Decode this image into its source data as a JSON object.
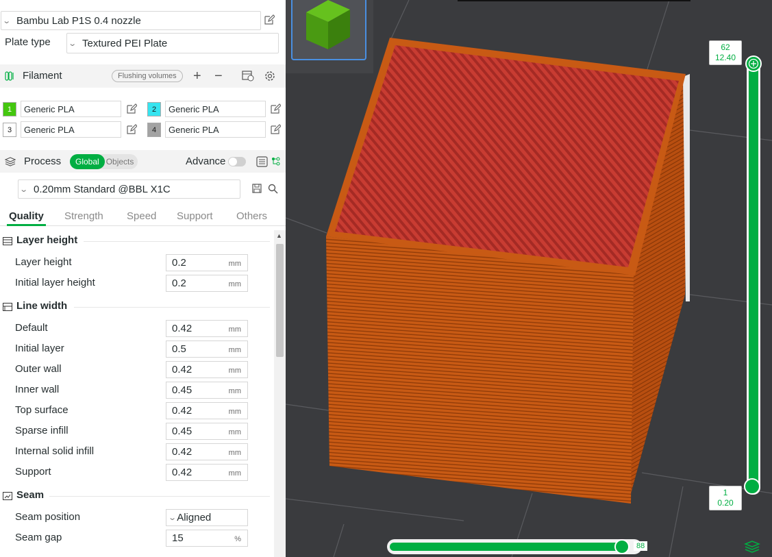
{
  "printer": {
    "name": "Bambu Lab P1S 0.4 nozzle"
  },
  "plate": {
    "label": "Plate type",
    "value": "Textured PEI Plate"
  },
  "filament": {
    "title": "Filament",
    "flushing_label": "Flushing volumes",
    "add_label": "+",
    "remove_label": "−",
    "slots": [
      {
        "index": "1",
        "name": "Generic PLA",
        "color": "#44c70f"
      },
      {
        "index": "2",
        "name": "Generic PLA",
        "color": "#36e4f0"
      },
      {
        "index": "3",
        "name": "Generic PLA",
        "color": "#ffffff"
      },
      {
        "index": "4",
        "name": "Generic PLA",
        "color": "#a3a3a3"
      }
    ]
  },
  "process": {
    "title": "Process",
    "global_label": "Global",
    "objects_label": "Objects",
    "advance_label": "Advance",
    "advance_on": false,
    "profile": "0.20mm Standard @BBL X1C"
  },
  "tabs": [
    "Quality",
    "Strength",
    "Speed",
    "Support",
    "Others"
  ],
  "active_tab": "Quality",
  "groups": {
    "layer_height": {
      "title": "Layer height",
      "rows": [
        {
          "label": "Layer height",
          "value": "0.2",
          "unit": "mm"
        },
        {
          "label": "Initial layer height",
          "value": "0.2",
          "unit": "mm"
        }
      ]
    },
    "line_width": {
      "title": "Line width",
      "rows": [
        {
          "label": "Default",
          "value": "0.42",
          "unit": "mm"
        },
        {
          "label": "Initial layer",
          "value": "0.5",
          "unit": "mm"
        },
        {
          "label": "Outer wall",
          "value": "0.42",
          "unit": "mm"
        },
        {
          "label": "Inner wall",
          "value": "0.45",
          "unit": "mm"
        },
        {
          "label": "Top surface",
          "value": "0.42",
          "unit": "mm"
        },
        {
          "label": "Sparse infill",
          "value": "0.45",
          "unit": "mm"
        },
        {
          "label": "Internal solid infill",
          "value": "0.42",
          "unit": "mm"
        },
        {
          "label": "Support",
          "value": "0.42",
          "unit": "mm"
        }
      ]
    },
    "seam": {
      "title": "Seam",
      "position_label": "Seam position",
      "position_value": "Aligned",
      "gap_label": "Seam gap",
      "gap_value": "15",
      "gap_unit": "%"
    }
  },
  "viewer": {
    "layer_top": {
      "number": "62",
      "height": "12.40"
    },
    "layer_bottom": {
      "number": "1",
      "height": "0.20"
    },
    "layer_slider_value": 1.0,
    "move_slider_value": "88",
    "move_slider_fraction": 0.96,
    "accent": "#00ae42",
    "model_color": "#c85a14",
    "top_surface_color": "#c83c32"
  }
}
